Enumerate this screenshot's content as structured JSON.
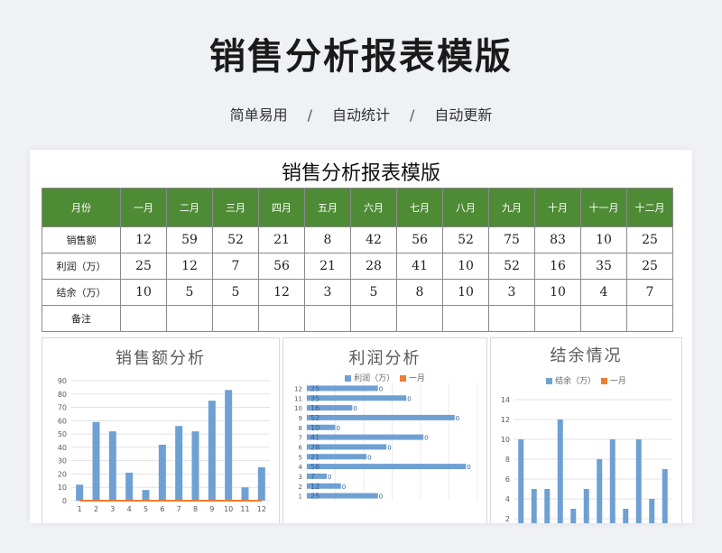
{
  "page": {
    "title": "销售分析报表模版",
    "subtitle_items": [
      "简单易用",
      "自动统计",
      "自动更新"
    ],
    "subtitle_separator": "/"
  },
  "sheet": {
    "title": "销售分析报表模版",
    "header": [
      "月份",
      "一月",
      "二月",
      "三月",
      "四月",
      "五月",
      "六月",
      "七月",
      "八月",
      "九月",
      "十月",
      "十一月",
      "十二月"
    ],
    "rows": [
      {
        "label": "销售额",
        "values": [
          "12",
          "59",
          "52",
          "21",
          "8",
          "42",
          "56",
          "52",
          "75",
          "83",
          "10",
          "25"
        ]
      },
      {
        "label": "利润（万）",
        "values": [
          "25",
          "12",
          "7",
          "56",
          "21",
          "28",
          "41",
          "10",
          "52",
          "16",
          "35",
          "25"
        ]
      },
      {
        "label": "结余（万）",
        "values": [
          "10",
          "5",
          "5",
          "12",
          "3",
          "5",
          "8",
          "10",
          "3",
          "10",
          "4",
          "7"
        ]
      },
      {
        "label": "备注",
        "values": [
          "",
          "",
          "",
          "",
          "",
          "",
          "",
          "",
          "",
          "",
          "",
          ""
        ]
      }
    ],
    "header_color": "#4e8b35"
  },
  "charts": {
    "sales": {
      "title": "销售额分析"
    },
    "profit": {
      "title": "利润分析",
      "legend": [
        "利润（万）",
        "一月"
      ]
    },
    "balance": {
      "title": "结余情况",
      "legend": [
        "结余（万）",
        "一月"
      ]
    }
  },
  "chart_data": [
    {
      "type": "bar",
      "title": "销售额分析",
      "categories": [
        "1",
        "2",
        "3",
        "4",
        "5",
        "6",
        "7",
        "8",
        "9",
        "10",
        "11",
        "12"
      ],
      "series": [
        {
          "values": [
            12,
            59,
            52,
            21,
            8,
            42,
            56,
            52,
            75,
            83,
            10,
            25
          ],
          "color": "#6fa0d3"
        },
        {
          "values": [
            0,
            0,
            0,
            0,
            0,
            0,
            0,
            0,
            0,
            0,
            0,
            0
          ],
          "color": "#ed7d31",
          "kind": "line"
        }
      ],
      "ylim": [
        0,
        90
      ],
      "yticks": [
        0,
        10,
        20,
        30,
        40,
        50,
        60,
        70,
        80,
        90
      ],
      "grid": true
    },
    {
      "type": "bar",
      "orientation": "horizontal",
      "title": "利润分析",
      "categories": [
        "1",
        "2",
        "3",
        "4",
        "5",
        "6",
        "7",
        "8",
        "9",
        "10",
        "11",
        "12"
      ],
      "series": [
        {
          "name": "利润（万）",
          "values": [
            25,
            12,
            7,
            56,
            21,
            28,
            41,
            10,
            52,
            16,
            35,
            25
          ],
          "color": "#6fa0d3"
        },
        {
          "name": "一月",
          "values": [
            0,
            0,
            0,
            0,
            0,
            0,
            0,
            0,
            0,
            0,
            0,
            0
          ],
          "color": "#ed7d31"
        }
      ],
      "grid": true
    },
    {
      "type": "bar",
      "title": "结余情况",
      "categories": [
        "1",
        "2",
        "3",
        "4",
        "5",
        "6",
        "7",
        "8",
        "9",
        "10",
        "11",
        "12"
      ],
      "series": [
        {
          "name": "结余（万）",
          "values": [
            10,
            5,
            5,
            12,
            3,
            5,
            8,
            10,
            3,
            10,
            4,
            7
          ],
          "color": "#6fa0d3"
        },
        {
          "name": "一月",
          "values": [
            0,
            0,
            0,
            0,
            0,
            0,
            0,
            0,
            0,
            0,
            0,
            0
          ],
          "color": "#ed7d31"
        }
      ],
      "ylim": [
        0,
        14
      ],
      "yticks": [
        0,
        2,
        4,
        6,
        8,
        10,
        12,
        14
      ],
      "grid": true
    }
  ]
}
